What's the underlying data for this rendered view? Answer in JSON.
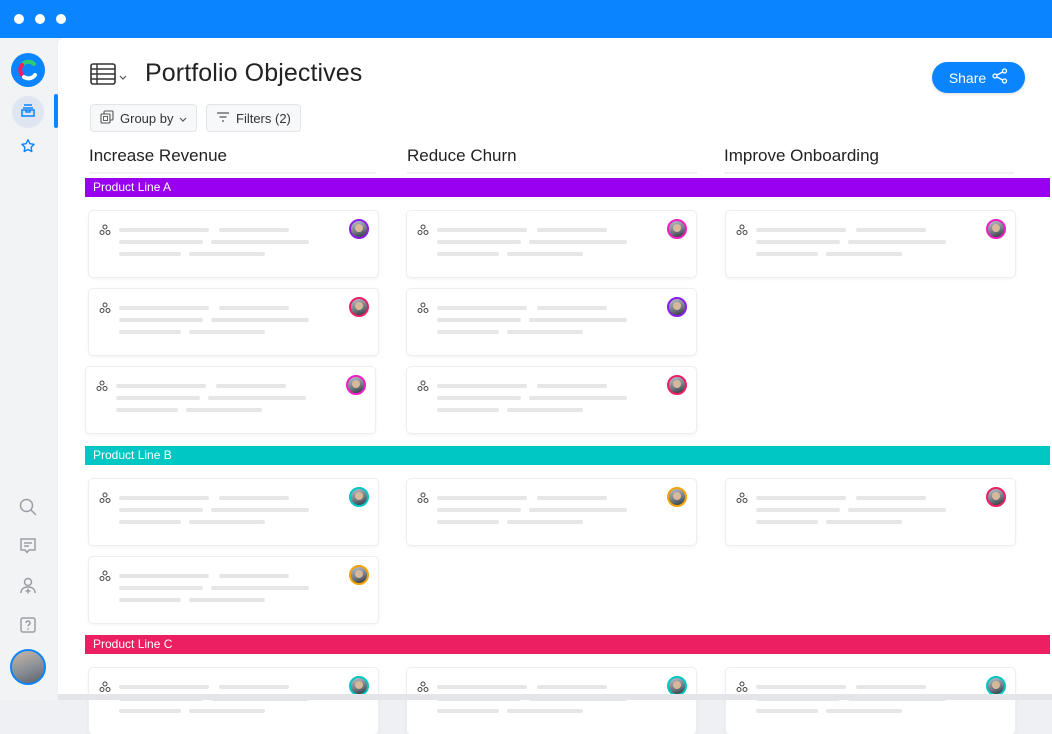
{
  "window": {
    "controls": [
      "close",
      "minimize",
      "maximize"
    ]
  },
  "sidebar": {
    "logo": "app-logo",
    "top_items": [
      {
        "name": "inbox",
        "icon": "inbox-icon",
        "active": true
      },
      {
        "name": "favorites",
        "icon": "star-icon",
        "active": false
      }
    ],
    "bottom_items": [
      {
        "name": "search",
        "icon": "search-icon"
      },
      {
        "name": "comments",
        "icon": "comment-icon"
      },
      {
        "name": "invite-user",
        "icon": "add-user-icon"
      },
      {
        "name": "help",
        "icon": "help-icon"
      }
    ],
    "user_avatar": "user-avatar"
  },
  "header": {
    "title": "Portfolio Objectives",
    "view_icon": "table-view-icon",
    "share_label": "Share"
  },
  "toolbar": {
    "group_by_label": "Group by",
    "filters_label": "Filters (2)"
  },
  "columns": [
    "Increase Revenue",
    "Reduce Churn",
    "Improve Onboarding"
  ],
  "colors": {
    "accent": "#0a84ff",
    "purple": "#9a00f0",
    "teal": "#00c7c3",
    "pink": "#ec1f63",
    "magenta": "#ee1ec4",
    "violet": "#8a1ee8",
    "orange": "#f5a20a"
  },
  "groups": [
    {
      "label": "Product Line A",
      "color": "#9a00f0",
      "cards": [
        [
          {
            "ring": "#8a1ee8"
          },
          {
            "ring": "#ec1f63"
          },
          {
            "ring": "#ee1ec4"
          }
        ],
        [
          {
            "ring": "#ee1ec4"
          },
          {
            "ring": "#8a1ee8"
          },
          {
            "ring": "#ec1f63"
          }
        ],
        [
          {
            "ring": "#ee1ec4"
          }
        ]
      ]
    },
    {
      "label": "Product Line B",
      "color": "#00c7c3",
      "cards": [
        [
          {
            "ring": "#00c7c3"
          },
          {
            "ring": "#f5a20a"
          }
        ],
        [
          {
            "ring": "#f5a20a"
          }
        ],
        [
          {
            "ring": "#ec1f63"
          }
        ]
      ]
    },
    {
      "label": "Product Line C",
      "color": "#ec1f63",
      "cards": [
        [
          {
            "ring": "#00c7c3"
          }
        ],
        [
          {
            "ring": "#00c7c3"
          }
        ],
        [
          {
            "ring": "#00c7c3"
          }
        ]
      ]
    }
  ]
}
